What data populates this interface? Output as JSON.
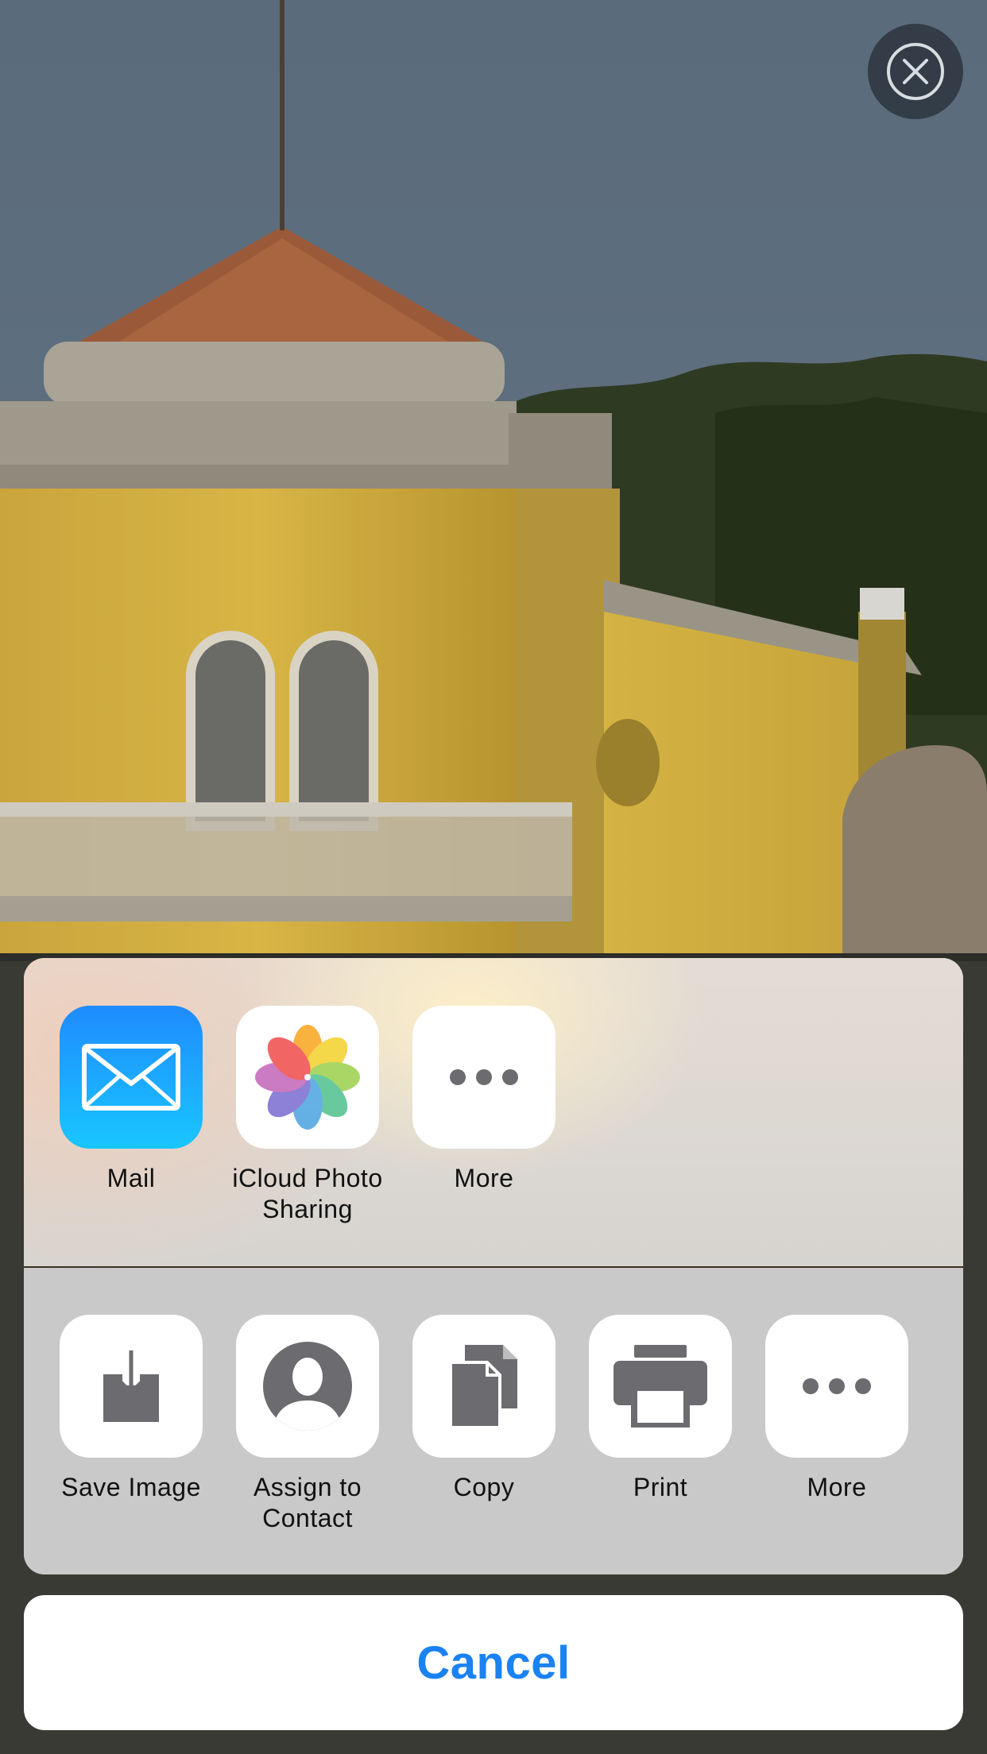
{
  "background": {
    "description_icon": "photo-yellow-villa"
  },
  "close_button": {
    "icon": "close-icon"
  },
  "share_sheet": {
    "apps": [
      {
        "label": "Mail",
        "icon": "mail-icon"
      },
      {
        "label": "iCloud Photo\nSharing",
        "icon": "photos-icon"
      },
      {
        "label": "More",
        "icon": "more-icon"
      }
    ],
    "actions": [
      {
        "label": "Save Image",
        "icon": "save-image-icon"
      },
      {
        "label": "Assign to\nContact",
        "icon": "contact-icon"
      },
      {
        "label": "Copy",
        "icon": "copy-icon"
      },
      {
        "label": "Print",
        "icon": "print-icon"
      },
      {
        "label": "More",
        "icon": "more-icon"
      }
    ]
  },
  "cancel_label": "Cancel",
  "colors": {
    "accent": "#1b82f2",
    "icon_gray": "#6b6b70",
    "mail_gradient_top": "#1f8bff",
    "mail_gradient_bottom": "#19c6ff"
  }
}
